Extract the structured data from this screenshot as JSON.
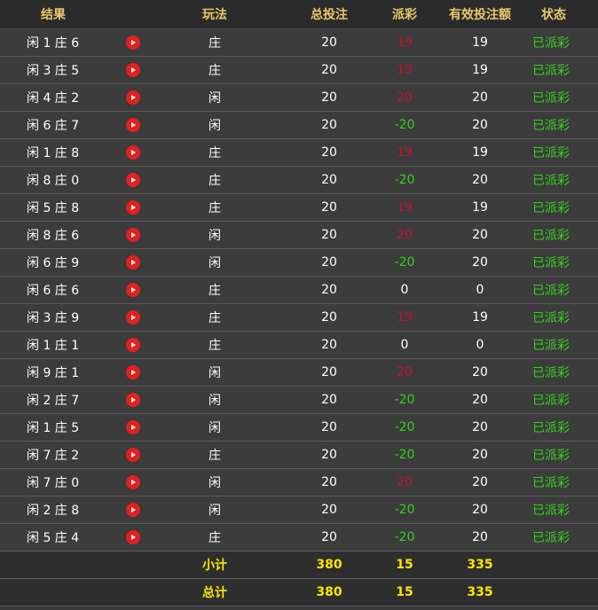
{
  "headers": {
    "result": "结果",
    "play": "玩法",
    "total": "总投注",
    "payout": "派彩",
    "valid": "有效投注额",
    "status": "状态"
  },
  "rows": [
    {
      "result": "闲 1 庄 6",
      "play": "庄",
      "total": "20",
      "payout": "19",
      "valid": "19",
      "status": "已派彩"
    },
    {
      "result": "闲 3 庄 5",
      "play": "庄",
      "total": "20",
      "payout": "19",
      "valid": "19",
      "status": "已派彩"
    },
    {
      "result": "闲 4 庄 2",
      "play": "闲",
      "total": "20",
      "payout": "20",
      "valid": "20",
      "status": "已派彩"
    },
    {
      "result": "闲 6 庄 7",
      "play": "闲",
      "total": "20",
      "payout": "-20",
      "valid": "20",
      "status": "已派彩"
    },
    {
      "result": "闲 1 庄 8",
      "play": "庄",
      "total": "20",
      "payout": "19",
      "valid": "19",
      "status": "已派彩"
    },
    {
      "result": "闲 8 庄 0",
      "play": "庄",
      "total": "20",
      "payout": "-20",
      "valid": "20",
      "status": "已派彩"
    },
    {
      "result": "闲 5 庄 8",
      "play": "庄",
      "total": "20",
      "payout": "19",
      "valid": "19",
      "status": "已派彩"
    },
    {
      "result": "闲 8 庄 6",
      "play": "闲",
      "total": "20",
      "payout": "20",
      "valid": "20",
      "status": "已派彩"
    },
    {
      "result": "闲 6 庄 9",
      "play": "闲",
      "total": "20",
      "payout": "-20",
      "valid": "20",
      "status": "已派彩"
    },
    {
      "result": "闲 6 庄 6",
      "play": "庄",
      "total": "20",
      "payout": "0",
      "valid": "0",
      "status": "已派彩"
    },
    {
      "result": "闲 3 庄 9",
      "play": "庄",
      "total": "20",
      "payout": "19",
      "valid": "19",
      "status": "已派彩"
    },
    {
      "result": "闲 1 庄 1",
      "play": "庄",
      "total": "20",
      "payout": "0",
      "valid": "0",
      "status": "已派彩"
    },
    {
      "result": "闲 9 庄 1",
      "play": "闲",
      "total": "20",
      "payout": "20",
      "valid": "20",
      "status": "已派彩"
    },
    {
      "result": "闲 2 庄 7",
      "play": "闲",
      "total": "20",
      "payout": "-20",
      "valid": "20",
      "status": "已派彩"
    },
    {
      "result": "闲 1 庄 5",
      "play": "闲",
      "total": "20",
      "payout": "-20",
      "valid": "20",
      "status": "已派彩"
    },
    {
      "result": "闲 7 庄 2",
      "play": "庄",
      "total": "20",
      "payout": "-20",
      "valid": "20",
      "status": "已派彩"
    },
    {
      "result": "闲 7 庄 0",
      "play": "闲",
      "total": "20",
      "payout": "20",
      "valid": "20",
      "status": "已派彩"
    },
    {
      "result": "闲 2 庄 8",
      "play": "闲",
      "total": "20",
      "payout": "-20",
      "valid": "20",
      "status": "已派彩"
    },
    {
      "result": "闲 5 庄 4",
      "play": "庄",
      "total": "20",
      "payout": "-20",
      "valid": "20",
      "status": "已派彩"
    }
  ],
  "summary": [
    {
      "label": "小计",
      "total": "380",
      "payout": "15",
      "valid": "335"
    },
    {
      "label": "总计",
      "total": "380",
      "payout": "15",
      "valid": "335"
    }
  ],
  "icons": {
    "video": "play-circle-icon"
  },
  "colors": {
    "header_text": "#e8c86a",
    "payout_positive": "#c8102e",
    "payout_negative": "#34d11c",
    "status": "#34d11c",
    "summary_text": "#ffe600",
    "play_icon": "#e41f1f"
  }
}
